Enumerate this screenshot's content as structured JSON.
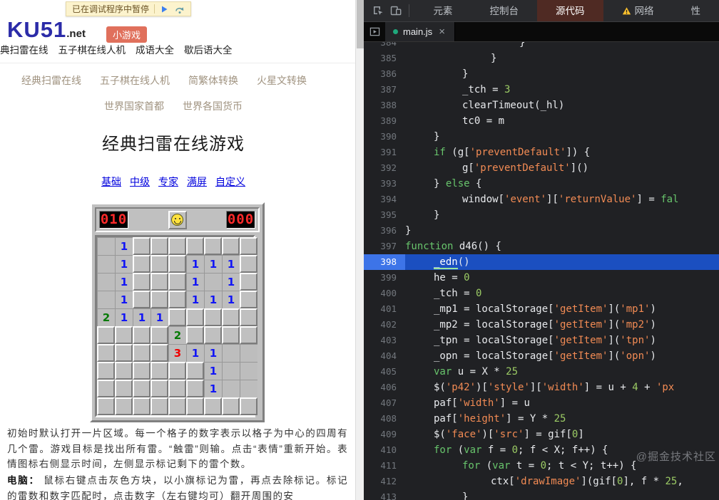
{
  "page": {
    "debug_bar": {
      "text": "已在调试程序中暂停"
    },
    "logo": {
      "main": "KU51",
      "suffix": ".net"
    },
    "badge": "小游戏",
    "nav_primary": [
      "典扫雷在线",
      "五子棋在线人机",
      "成语大全",
      "歇后语大全"
    ],
    "nav_secondary": [
      "经典扫雷在线",
      "五子棋在线人机",
      "简繁体转换",
      "火星文转换"
    ],
    "nav_tertiary": [
      "世界国家首都",
      "世界各国货币"
    ],
    "title": "经典扫雷在线游戏",
    "mode_links": [
      "基础",
      "中级",
      "专家",
      "满屏",
      "自定义"
    ],
    "game": {
      "mine_counter": "010",
      "timer": "000",
      "number_colors": {
        "1": "#1216f5",
        "2": "#067a06",
        "3": "#f00000"
      },
      "grid": [
        [
          "",
          "1",
          "u",
          "u",
          "u",
          "u",
          "u",
          "u",
          "u"
        ],
        [
          "",
          "1",
          "u",
          "u",
          "u",
          "1",
          "1",
          "1",
          "u"
        ],
        [
          "",
          "1",
          "u",
          "u",
          "u",
          "1",
          "",
          "1",
          "u"
        ],
        [
          "",
          "1",
          "u",
          "u",
          "u",
          "1",
          "1",
          "1",
          "u"
        ],
        [
          "2",
          "1",
          "1",
          "1",
          "u",
          "u",
          "u",
          "u",
          "u"
        ],
        [
          "u",
          "u",
          "u",
          "u",
          "2",
          "u",
          "u",
          "u",
          "u"
        ],
        [
          "u",
          "u",
          "u",
          "u",
          "3",
          "1",
          "1",
          "",
          ""
        ],
        [
          "u",
          "u",
          "u",
          "u",
          "u",
          "u",
          "1",
          "",
          ""
        ],
        [
          "u",
          "u",
          "u",
          "u",
          "u",
          "u",
          "1",
          "",
          ""
        ],
        [
          "u",
          "u",
          "u",
          "u",
          "u",
          "u",
          "u",
          "u",
          "u"
        ]
      ]
    },
    "help": {
      "p1": "初始时默认打开一片区域。每一个格子的数字表示以格子为中心的四周有几个雷。游戏目标是找出所有雷。“触雷”则输。点击“表情”重新开始。表情图标右侧显示时间，左侧显示标记剩下的雷个数。",
      "p2_label": "电脑：",
      "p2": " 鼠标右键点击灰色方块，以小旗标记为雷，再点去除标记。标记的雷数和数字匹配时，点击数字（左右键均可）翻开周围的安"
    }
  },
  "devtools": {
    "panel_tabs": [
      {
        "name": "devtools-tab-elements",
        "label": "元素",
        "selected": false,
        "warning": false
      },
      {
        "name": "devtools-tab-console",
        "label": "控制台",
        "selected": false,
        "warning": false
      },
      {
        "name": "devtools-tab-sources",
        "label": "源代码",
        "selected": true,
        "warning": false
      },
      {
        "name": "devtools-tab-network",
        "label": "网络",
        "selected": false,
        "warning": true
      },
      {
        "name": "devtools-tab-performance",
        "label": "性",
        "selected": false,
        "warning": false
      }
    ],
    "file_tab": {
      "name": "main.js",
      "close_glyph": "×"
    },
    "watermark": "@掘金技术社区",
    "paused_line": 398,
    "code_lines": [
      {
        "n": 384,
        "i": 4,
        "t": [
          [
            "p",
            "}"
          ]
        ]
      },
      {
        "n": 385,
        "i": 3,
        "t": [
          [
            "p",
            "}"
          ]
        ]
      },
      {
        "n": 386,
        "i": 2,
        "t": [
          [
            "p",
            "}"
          ]
        ]
      },
      {
        "n": 387,
        "i": 2,
        "t": [
          [
            "p",
            "_tch = "
          ],
          [
            "n",
            "3"
          ]
        ]
      },
      {
        "n": 388,
        "i": 2,
        "t": [
          [
            "p",
            "clearTimeout(_hl)"
          ]
        ]
      },
      {
        "n": 389,
        "i": 2,
        "t": [
          [
            "p",
            "tc0 = m"
          ]
        ]
      },
      {
        "n": 390,
        "i": 1,
        "t": [
          [
            "p",
            "}"
          ]
        ]
      },
      {
        "n": 391,
        "i": 1,
        "t": [
          [
            "k",
            "if"
          ],
          [
            "p",
            " (g["
          ],
          [
            "s",
            "'preventDefault'"
          ],
          [
            "p",
            "]) {"
          ]
        ]
      },
      {
        "n": 392,
        "i": 2,
        "t": [
          [
            "p",
            "g["
          ],
          [
            "s",
            "'preventDefault'"
          ],
          [
            "p",
            "]()"
          ]
        ]
      },
      {
        "n": 393,
        "i": 1,
        "t": [
          [
            "p",
            "} "
          ],
          [
            "k",
            "else"
          ],
          [
            "p",
            " {"
          ]
        ]
      },
      {
        "n": 394,
        "i": 2,
        "t": [
          [
            "p",
            "window["
          ],
          [
            "s",
            "'event'"
          ],
          [
            "p",
            "]["
          ],
          [
            "s",
            "'returnValue'"
          ],
          [
            "p",
            "] = "
          ],
          [
            "k",
            "fal"
          ]
        ]
      },
      {
        "n": 395,
        "i": 1,
        "t": [
          [
            "p",
            "}"
          ]
        ]
      },
      {
        "n": 396,
        "i": 0,
        "t": [
          [
            "p",
            "}"
          ]
        ]
      },
      {
        "n": 397,
        "i": 0,
        "t": [
          [
            "k",
            "function"
          ],
          [
            "p",
            " d46() {"
          ]
        ]
      },
      {
        "n": 398,
        "i": 1,
        "t": [
          [
            "x",
            "_edn"
          ],
          [
            "p",
            "()"
          ]
        ]
      },
      {
        "n": 399,
        "i": 1,
        "t": [
          [
            "p",
            "he = "
          ],
          [
            "n",
            "0"
          ]
        ]
      },
      {
        "n": 400,
        "i": 1,
        "t": [
          [
            "p",
            "_tch = "
          ],
          [
            "n",
            "0"
          ]
        ]
      },
      {
        "n": 401,
        "i": 1,
        "t": [
          [
            "p",
            "_mp1 = localStorage["
          ],
          [
            "s",
            "'getItem'"
          ],
          [
            "p",
            "]("
          ],
          [
            "s",
            "'mp1'"
          ],
          [
            "p",
            ")"
          ]
        ]
      },
      {
        "n": 402,
        "i": 1,
        "t": [
          [
            "p",
            "_mp2 = localStorage["
          ],
          [
            "s",
            "'getItem'"
          ],
          [
            "p",
            "]("
          ],
          [
            "s",
            "'mp2'"
          ],
          [
            "p",
            ")"
          ]
        ]
      },
      {
        "n": 403,
        "i": 1,
        "t": [
          [
            "p",
            "_tpn = localStorage["
          ],
          [
            "s",
            "'getItem'"
          ],
          [
            "p",
            "]("
          ],
          [
            "s",
            "'tpn'"
          ],
          [
            "p",
            ")"
          ]
        ]
      },
      {
        "n": 404,
        "i": 1,
        "t": [
          [
            "p",
            "_opn = localStorage["
          ],
          [
            "s",
            "'getItem'"
          ],
          [
            "p",
            "]("
          ],
          [
            "s",
            "'opn'"
          ],
          [
            "p",
            ")"
          ]
        ]
      },
      {
        "n": 405,
        "i": 1,
        "t": [
          [
            "k",
            "var"
          ],
          [
            "p",
            " u = X * "
          ],
          [
            "n",
            "25"
          ]
        ]
      },
      {
        "n": 406,
        "i": 1,
        "t": [
          [
            "p",
            "$("
          ],
          [
            "s",
            "'p42'"
          ],
          [
            "p",
            ")["
          ],
          [
            "s",
            "'style'"
          ],
          [
            "p",
            "]["
          ],
          [
            "s",
            "'width'"
          ],
          [
            "p",
            "] = u + "
          ],
          [
            "n",
            "4"
          ],
          [
            "p",
            " + "
          ],
          [
            "s",
            "'px"
          ]
        ]
      },
      {
        "n": 407,
        "i": 1,
        "t": [
          [
            "p",
            "paf["
          ],
          [
            "s",
            "'width'"
          ],
          [
            "p",
            "] = u"
          ]
        ]
      },
      {
        "n": 408,
        "i": 1,
        "t": [
          [
            "p",
            "paf["
          ],
          [
            "s",
            "'height'"
          ],
          [
            "p",
            "] = Y * "
          ],
          [
            "n",
            "25"
          ]
        ]
      },
      {
        "n": 409,
        "i": 1,
        "t": [
          [
            "p",
            "$("
          ],
          [
            "s",
            "'face'"
          ],
          [
            "p",
            ")["
          ],
          [
            "s",
            "'src'"
          ],
          [
            "p",
            "] = gif["
          ],
          [
            "n",
            "0"
          ],
          [
            "p",
            "]"
          ]
        ]
      },
      {
        "n": 410,
        "i": 1,
        "t": [
          [
            "k",
            "for"
          ],
          [
            "p",
            " ("
          ],
          [
            "k",
            "var"
          ],
          [
            "p",
            " f = "
          ],
          [
            "n",
            "0"
          ],
          [
            "p",
            "; f < X; f++) {"
          ]
        ]
      },
      {
        "n": 411,
        "i": 2,
        "t": [
          [
            "k",
            "for"
          ],
          [
            "p",
            " ("
          ],
          [
            "k",
            "var"
          ],
          [
            "p",
            " t = "
          ],
          [
            "n",
            "0"
          ],
          [
            "p",
            "; t < Y; t++) {"
          ]
        ]
      },
      {
        "n": 412,
        "i": 3,
        "t": [
          [
            "p",
            "ctx["
          ],
          [
            "s",
            "'drawImage'"
          ],
          [
            "p",
            "](gif["
          ],
          [
            "n",
            "0"
          ],
          [
            "p",
            "], f * "
          ],
          [
            "n",
            "25"
          ],
          [
            "p",
            ","
          ]
        ]
      },
      {
        "n": 413,
        "i": 2,
        "t": [
          [
            "p",
            "}"
          ]
        ]
      }
    ]
  },
  "icons": {
    "resume-icon": "play-triangle",
    "step-over-icon": "curved-arrow",
    "inspect-icon": "cursor-in-box",
    "device-toolbar-icon": "phone-tablet",
    "warning-icon": "yellow-triangle-exclaim",
    "navigator-toggle-icon": "panel-with-arrow",
    "close-icon": "×",
    "modified-dot-icon": "teal-dot"
  },
  "colors": {
    "exec_line_bg": "#1b4fc0",
    "exec_gutter_bg": "#3d74e8",
    "keyword": "#68c56c",
    "string": "#f28b54",
    "number": "#9ccc65",
    "selected_tab_bg": "#4f2a23",
    "led_red": "#ff2a2a",
    "board_gray": "#c0c0c0"
  }
}
